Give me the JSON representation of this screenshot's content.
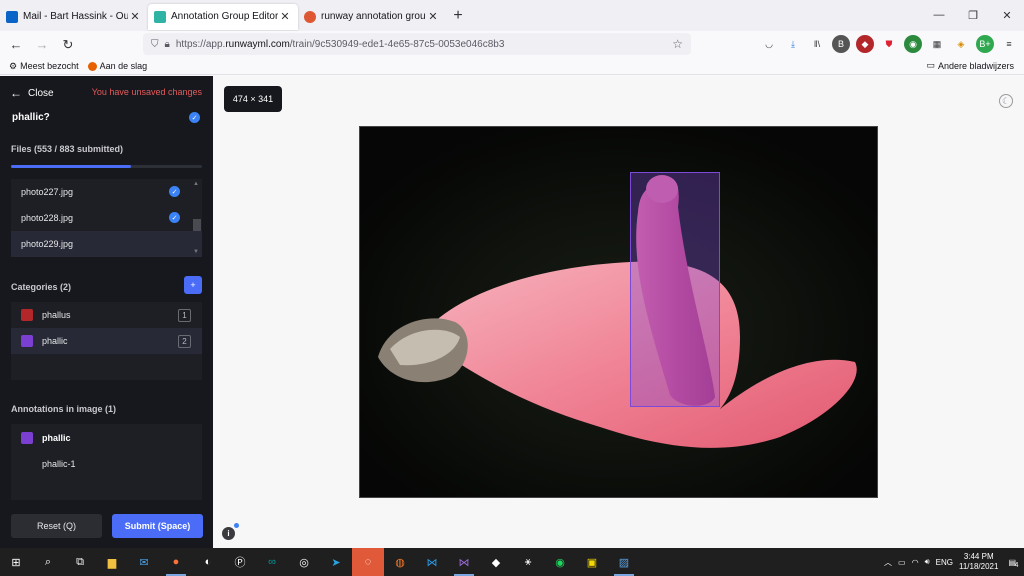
{
  "browser": {
    "tabs": [
      {
        "title": "Mail - Bart Hassink - Outlook",
        "favicon_color": "#0a64c8",
        "active": false
      },
      {
        "title": "Annotation Group Editor — ph",
        "favicon_color": "#2fb3a4",
        "active": true
      },
      {
        "title": "runway annotation group at Du",
        "favicon_color": "#de5833",
        "active": false
      }
    ],
    "new_tab_symbol": "+",
    "window_controls": [
      "—",
      "❐",
      "✕"
    ],
    "url_prefix": "https://app.",
    "url_domain": "runwayml.com",
    "url_path": "/train/9c530949-ede1-4e65-87c5-0053e046c8b3",
    "bookmarks": [
      {
        "label": "Meest bezocht",
        "icon": "gear-icon"
      },
      {
        "label": "Aan de slag",
        "icon": "firefox-icon"
      }
    ],
    "other_bookmarks": "Andere bladwijzers"
  },
  "sidebar": {
    "close_label": "Close",
    "unsaved_label": "You have unsaved changes",
    "group_title": "phallic?",
    "files_heading": "Files (553 / 883 submitted)",
    "files_progress": 0.63,
    "files": [
      {
        "name": "photo227.jpg",
        "checked": true,
        "selected": false
      },
      {
        "name": "photo228.jpg",
        "checked": true,
        "selected": false
      },
      {
        "name": "photo229.jpg",
        "checked": false,
        "selected": true
      }
    ],
    "categories_heading": "Categories (2)",
    "add_category_label": "+",
    "categories": [
      {
        "name": "phallus",
        "color": "#b3262a",
        "hotkey": "1",
        "selected": false
      },
      {
        "name": "phallic",
        "color": "#7b3fd1",
        "hotkey": "2",
        "selected": true
      }
    ],
    "annotations_heading": "Annotations in image (1)",
    "annotation_category": {
      "name": "phallic",
      "color": "#7b3fd1"
    },
    "annotation_items": [
      "phallic-1"
    ],
    "reset_label": "Reset (Q)",
    "submit_label": "Submit (Space)"
  },
  "canvas": {
    "image_dims": "474 × 341",
    "info_label": "i"
  },
  "taskbar": {
    "language": "ENG",
    "time": "3:44 PM",
    "date": "11/18/2021",
    "notification_count": "4"
  }
}
